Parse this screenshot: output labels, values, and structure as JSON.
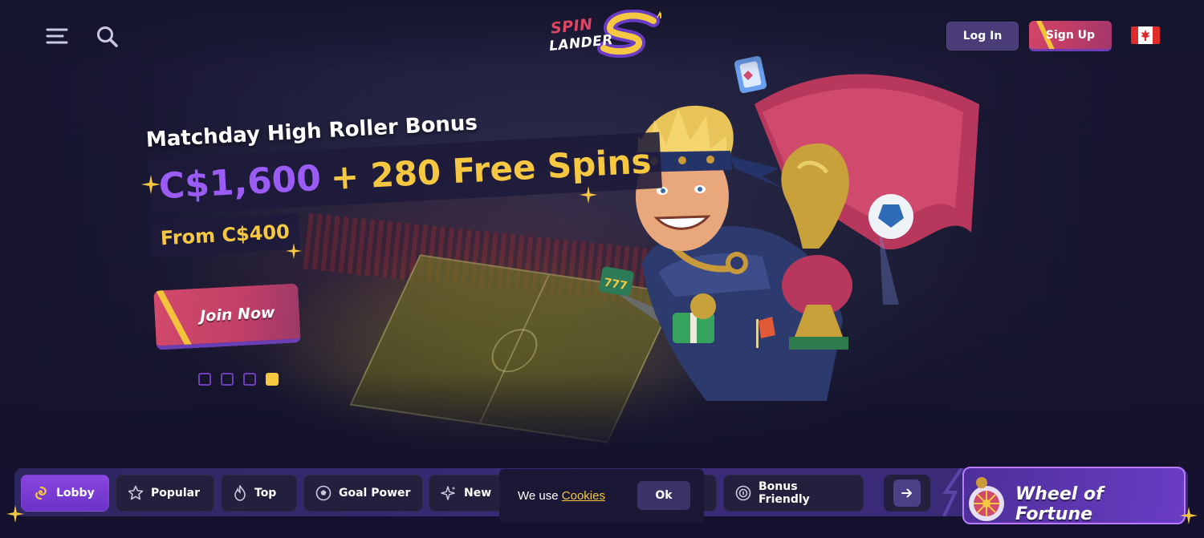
{
  "header": {
    "login_label": "Log In",
    "signup_label": "Sign Up",
    "logo_line1": "SPIN",
    "logo_line2": "LANDER",
    "country_flag": "canada-flag-icon"
  },
  "promo": {
    "title": "Matchday High Roller Bonus",
    "amount": "C$1,600",
    "free_spins": "+ 280 Free Spins",
    "min_deposit": "From C$400",
    "cta_label": "Join Now",
    "slide_count": 4,
    "active_slide": 4
  },
  "categories": [
    {
      "label": "Lobby",
      "icon": "lobby-swirl-icon",
      "active": true
    },
    {
      "label": "Popular",
      "icon": "star-icon",
      "active": false
    },
    {
      "label": "Top",
      "icon": "flame-icon",
      "active": false
    },
    {
      "label": "Goal Power",
      "icon": "soccer-ball-icon",
      "active": false
    },
    {
      "label": "New",
      "icon": "sparkle-icon",
      "active": false
    },
    {
      "label": "Bonus Friendly",
      "icon": "bonus-coin-icon",
      "active": false
    }
  ],
  "wheel": {
    "label": "Wheel of Fortune"
  },
  "cookie": {
    "text": "We use",
    "link": "Cookies",
    "ok_label": "Ok"
  },
  "colors": {
    "background": "#13112e",
    "accent_purple": "#9b5cf5",
    "accent_yellow": "#f6c842",
    "accent_pink": "#d1466a"
  }
}
